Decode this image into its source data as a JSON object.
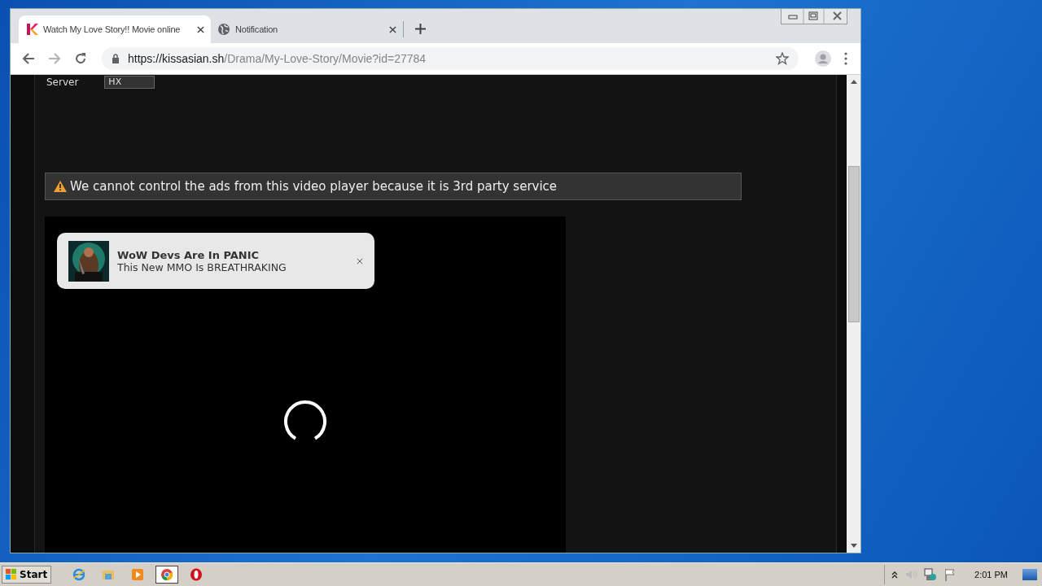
{
  "browser": {
    "tabs": [
      {
        "title": "Watch My Love Story!! Movie online",
        "selected": true
      },
      {
        "title": "Notification",
        "selected": false
      }
    ],
    "address": {
      "host": "https://kissasian.sh",
      "path": "/Drama/My-Love-Story/Movie?id=27784"
    }
  },
  "page": {
    "server_label": "Server",
    "server_value": "HX",
    "warning": "We cannot control the ads from this video player because it is 3rd party service",
    "notification": {
      "title": "WoW Devs Are In PANIC",
      "body": "This New MMO Is BREATHRAKING"
    }
  },
  "taskbar": {
    "start": "Start",
    "apps": [
      {
        "kind": "ie",
        "selected": false
      },
      {
        "kind": "folder",
        "selected": false
      },
      {
        "kind": "media",
        "selected": false
      },
      {
        "kind": "chrome",
        "selected": true
      },
      {
        "kind": "opera",
        "selected": false
      }
    ],
    "clock": "2:01 PM"
  }
}
